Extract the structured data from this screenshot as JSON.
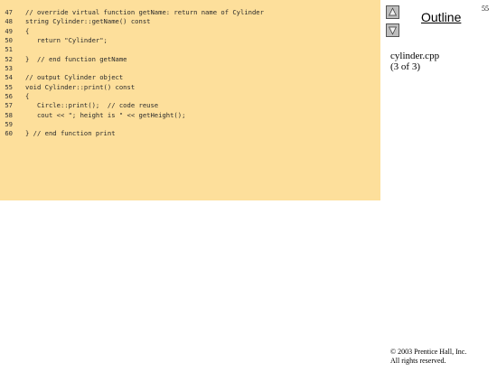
{
  "code": {
    "lines": [
      {
        "number": "47",
        "text": "// override virtual function getName: return name of Cylinder"
      },
      {
        "number": "48",
        "text": "string Cylinder::getName() const"
      },
      {
        "number": "49",
        "text": "{"
      },
      {
        "number": "50",
        "text": "   return \"Cylinder\";"
      },
      {
        "number": "51",
        "text": ""
      },
      {
        "number": "52",
        "text": "}  // end function getName"
      },
      {
        "number": "53",
        "text": ""
      },
      {
        "number": "54",
        "text": "// output Cylinder object"
      },
      {
        "number": "55",
        "text": "void Cylinder::print() const"
      },
      {
        "number": "56",
        "text": "{"
      },
      {
        "number": "57",
        "text": "   Circle::print();  // code reuse"
      },
      {
        "number": "58",
        "text": "   cout << \"; height is \" << getHeight();"
      },
      {
        "number": "59",
        "text": ""
      },
      {
        "number": "60",
        "text": "} // end function print"
      }
    ]
  },
  "sidebar": {
    "title": "Outline",
    "page_number": "55",
    "file_name": "cylinder.cpp",
    "slide_counter": "(3 of 3)",
    "up_icon": "triangle-up-icon",
    "down_icon": "triangle-down-icon"
  },
  "footer": {
    "copyright_line1": "© 2003 Prentice Hall, Inc.",
    "copyright_line2": "All rights reserved."
  },
  "colors": {
    "code_background": "#fddf9b",
    "button_background": "#bdbdbd"
  }
}
